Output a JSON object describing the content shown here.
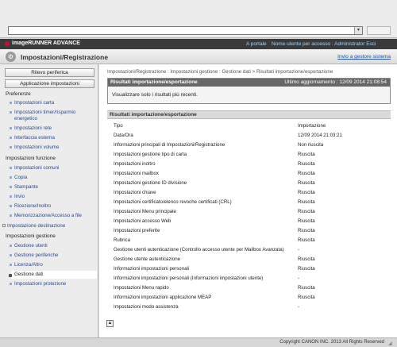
{
  "browser": {
    "address_value": ""
  },
  "header": {
    "brand": "imageRUNNER ADVANCE",
    "portal_link": "A portale",
    "user_info": "Nome utente per accesso : Administrator Esci",
    "page_title": "Impostazioni/Registrazione",
    "goto_system": "Invio a gestore sistema"
  },
  "sidebar": {
    "btn_check_device": "Rilevo periferica",
    "btn_apply": "Applicazione impostazioni",
    "groups": [
      {
        "title": "Preferenze",
        "items": [
          "Impostazioni carta",
          "Impostazioni timer/risparmio energetico",
          "Impostazioni rete",
          "Interfaccia esterna",
          "Impostazioni volume"
        ]
      },
      {
        "title": "Impostazioni funzione",
        "items": [
          "Impostazioni comuni",
          "Copia",
          "Stampante",
          "Invio",
          "Ricezione/Inoltro",
          "Memorizzazione/Accesso a file"
        ]
      },
      {
        "title": "Impostazione destinazione",
        "items": []
      },
      {
        "title": "Impostazioni gestione",
        "items": [
          "Gestione utenti",
          "Gestione periferiche",
          "Licenza/Altro",
          "Gestione dati",
          "Impostazioni protezione"
        ]
      }
    ]
  },
  "main": {
    "breadcrumb": "Impostazioni/Registrazione : Impostazioni gestione : Gestione dati > Risultati importazione/esportazione",
    "panel1": {
      "title": "Risultati importazione/esportazione",
      "last_update": "Ultimo aggiornamento : 12/09 2014 21:08:54",
      "note": "Visualizzare solo i risultati più recenti."
    },
    "panel2": {
      "title": "Risultati importazione/esportazione",
      "rows": [
        [
          "Tipo",
          "Importazione"
        ],
        [
          "Data/Ora",
          "12/09 2014 21:03:21"
        ],
        [
          "Informazioni principali di Impostazioni/Registrazione",
          "Non riuscita"
        ],
        [
          "Impostazioni gestione tipo di carta",
          "Riuscita"
        ],
        [
          "Impostazioni inoltro",
          "Riuscita"
        ],
        [
          "Impostazioni mailbox",
          "Riuscita"
        ],
        [
          "Impostazioni gestione ID divisione",
          "Riuscita"
        ],
        [
          "Impostazioni chiave",
          "Riuscita"
        ],
        [
          "Impostazioni certificato/elenco revoche certificati (CRL)",
          "Riuscita"
        ],
        [
          "Impostazioni Menu principale",
          "Riuscita"
        ],
        [
          "Impostazioni accesso Web",
          "Riuscita"
        ],
        [
          "Impostazioni preferite",
          "Riuscita"
        ],
        [
          "Rubrica",
          "Riuscita"
        ],
        [
          "Gestione utenti autenticazione (Controllo accesso utente per Mailbox Avanzata)",
          "-"
        ],
        [
          "Gestione utente autenticazione",
          "Riuscita"
        ],
        [
          "Informazioni impostazioni personali",
          "Riuscita"
        ],
        [
          "Informazioni impostazioni personali (Informazioni impostazioni utente)",
          "-"
        ],
        [
          "Impostazioni Menu rapido",
          "Riuscita"
        ],
        [
          "Informazioni impostazioni applicazione MEAP",
          "Riuscita"
        ],
        [
          "Impostazioni modo assistenza",
          "-"
        ]
      ]
    }
  },
  "footer": {
    "copyright": "Copyright CANON INC. 2013 All Rights Reserved"
  },
  "colors": {
    "accent_link": "#2055a8",
    "header_bar": "#3a3a3a",
    "brand_red": "#c8102e"
  }
}
